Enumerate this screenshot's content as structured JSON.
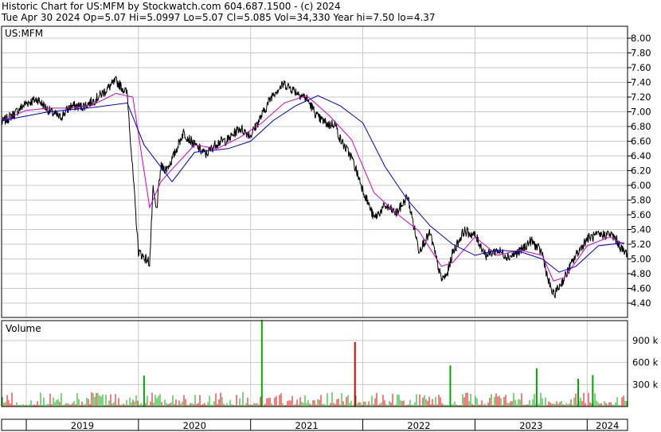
{
  "header": {
    "line1": "Historic Chart for US:MFM by Stockwatch.com 604.687.1500 - (c) 2024",
    "line2": "Tue Apr 30 2024  Op=5.07  Hi=5.0997  Lo=5.07  Cl=5.085  Vol=34,330  Year hi=7.50  lo=4.37"
  },
  "colors": {
    "price": "#000000",
    "ma_short": "#cc00cc",
    "ma_long": "#0000cc",
    "vol_up": "#00aa00",
    "vol_down": "#dd0000",
    "grid": "#c8c8c8"
  },
  "chart_data": [
    {
      "type": "line",
      "title": "US:MFM",
      "x_labels": [
        "2019",
        "2020",
        "2021",
        "2022",
        "2023",
        "2024"
      ],
      "ylim": [
        4.2,
        8.1
      ],
      "y_ticks": [
        "8.00",
        "7.80",
        "7.60",
        "7.40",
        "7.20",
        "7.00",
        "6.80",
        "6.60",
        "6.40",
        "6.20",
        "6.00",
        "5.80",
        "5.60",
        "5.40",
        "5.20",
        "5.00",
        "4.80",
        "4.60",
        "4.40"
      ],
      "grid": true,
      "series": [
        {
          "x": [
            2018.78,
            2018.9,
            2019.0,
            2019.1,
            2019.2,
            2019.3,
            2019.4,
            2019.5,
            2019.6,
            2019.7,
            2019.8,
            2019.9,
            2020.0,
            2020.1,
            2020.13,
            2020.16,
            2020.2,
            2020.25,
            2020.3,
            2020.4,
            2020.5,
            2020.6,
            2020.7,
            2020.8,
            2020.9,
            2021.0,
            2021.1,
            2021.2,
            2021.3,
            2021.4,
            2021.5,
            2021.6,
            2021.7,
            2021.75,
            2021.8,
            2021.9,
            2022.0,
            2022.1,
            2022.2,
            2022.3,
            2022.4,
            2022.5,
            2022.6,
            2022.7,
            2022.75,
            2022.8,
            2022.9,
            2023.0,
            2023.1,
            2023.2,
            2023.3,
            2023.4,
            2023.5,
            2023.6,
            2023.65,
            2023.7,
            2023.8,
            2023.9,
            2024.0,
            2024.1,
            2024.2,
            2024.25,
            2024.33
          ],
          "y": [
            6.85,
            6.98,
            7.12,
            7.17,
            7.02,
            6.92,
            7.08,
            7.07,
            7.15,
            7.28,
            7.42,
            7.25,
            5.1,
            4.95,
            5.95,
            5.65,
            6.25,
            6.22,
            6.35,
            6.72,
            6.55,
            6.42,
            6.58,
            6.62,
            6.78,
            6.68,
            6.95,
            7.25,
            7.38,
            7.28,
            7.18,
            6.92,
            6.82,
            6.85,
            6.62,
            6.38,
            5.95,
            5.55,
            5.72,
            5.62,
            5.85,
            5.12,
            5.35,
            4.72,
            4.78,
            5.08,
            5.38,
            5.32,
            5.05,
            5.12,
            5.03,
            5.1,
            5.25,
            5.08,
            4.72,
            4.5,
            4.75,
            5.05,
            5.28,
            5.32,
            5.34,
            5.28,
            5.085
          ]
        },
        {
          "x": [
            2018.78,
            2019.0,
            2019.2,
            2019.4,
            2019.6,
            2019.8,
            2019.95,
            2020.1,
            2020.2,
            2020.3,
            2020.5,
            2020.7,
            2020.9,
            2021.1,
            2021.3,
            2021.5,
            2021.7,
            2021.9,
            2022.1,
            2022.3,
            2022.5,
            2022.7,
            2022.8,
            2023.0,
            2023.2,
            2023.4,
            2023.6,
            2023.7,
            2023.8,
            2024.0,
            2024.2,
            2024.33
          ],
          "y": [
            6.88,
            7.02,
            7.05,
            7.05,
            7.1,
            7.25,
            7.2,
            5.7,
            6.05,
            6.22,
            6.55,
            6.5,
            6.65,
            6.85,
            7.12,
            7.22,
            6.95,
            6.62,
            5.9,
            5.62,
            5.38,
            4.9,
            4.95,
            5.3,
            5.05,
            5.12,
            5.05,
            4.7,
            4.75,
            5.18,
            5.3,
            5.2
          ]
        },
        {
          "x": [
            2018.78,
            2019.2,
            2019.6,
            2019.9,
            2020.05,
            2020.3,
            2020.5,
            2020.8,
            2021.0,
            2021.2,
            2021.4,
            2021.6,
            2021.8,
            2022.0,
            2022.2,
            2022.4,
            2022.6,
            2022.8,
            2023.0,
            2023.2,
            2023.4,
            2023.6,
            2023.75,
            2023.9,
            2024.1,
            2024.33
          ],
          "y": [
            6.88,
            7.0,
            7.06,
            7.12,
            6.55,
            6.05,
            6.45,
            6.5,
            6.6,
            6.88,
            7.08,
            7.22,
            7.08,
            6.85,
            6.25,
            5.8,
            5.45,
            5.2,
            5.05,
            5.12,
            5.1,
            5.0,
            4.82,
            4.9,
            5.18,
            5.22
          ]
        }
      ]
    },
    {
      "type": "bar",
      "title": "Volume",
      "y_ticks": [
        "900 k",
        "600 k",
        "300 k"
      ],
      "ylim": [
        0,
        1300
      ],
      "grid": true,
      "notable_bars": [
        {
          "x": 2021.1,
          "value": 1180,
          "direction": "up"
        },
        {
          "x": 2021.93,
          "value": 880,
          "direction": "down"
        },
        {
          "x": 2022.78,
          "value": 560,
          "direction": "up"
        },
        {
          "x": 2023.55,
          "value": 520,
          "direction": "up"
        },
        {
          "x": 2020.05,
          "value": 420,
          "direction": "up"
        },
        {
          "x": 2024.05,
          "value": 430,
          "direction": "up"
        },
        {
          "x": 2023.92,
          "value": 380,
          "direction": "up"
        }
      ]
    }
  ]
}
